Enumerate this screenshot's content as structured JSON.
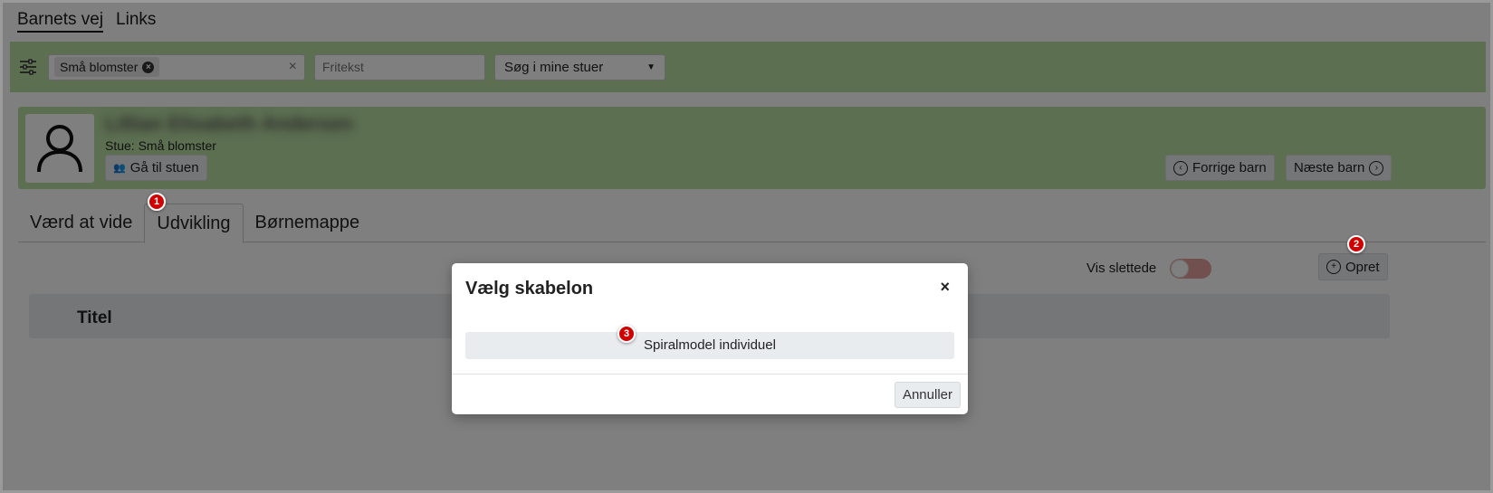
{
  "topnav": {
    "items": [
      "Barnets vej",
      "Links"
    ]
  },
  "filter": {
    "chip_label": "Små blomster",
    "search_placeholder": "Fritekst",
    "scope_selected": "Søg i mine stuer"
  },
  "child": {
    "name": "Lillian Elisabeth Andersen",
    "room": "Stue: Små blomster",
    "goto_label": "Gå til stuen",
    "prev_label": "Forrige barn",
    "next_label": "Næste barn"
  },
  "tabs": [
    "Værd at vide",
    "Udvikling",
    "Børnemappe"
  ],
  "content": {
    "show_deleted_label": "Vis slettede",
    "create_label": "Opret",
    "table_header_title": "Titel"
  },
  "modal": {
    "title": "Vælg skabelon",
    "close_glyph": "×",
    "template_label": "Spiralmodel individuel",
    "cancel_label": "Annuller"
  },
  "badges": [
    "1",
    "2",
    "3"
  ],
  "colors": {
    "accent_green": "#b9dea3",
    "badge_red": "#d10000"
  }
}
